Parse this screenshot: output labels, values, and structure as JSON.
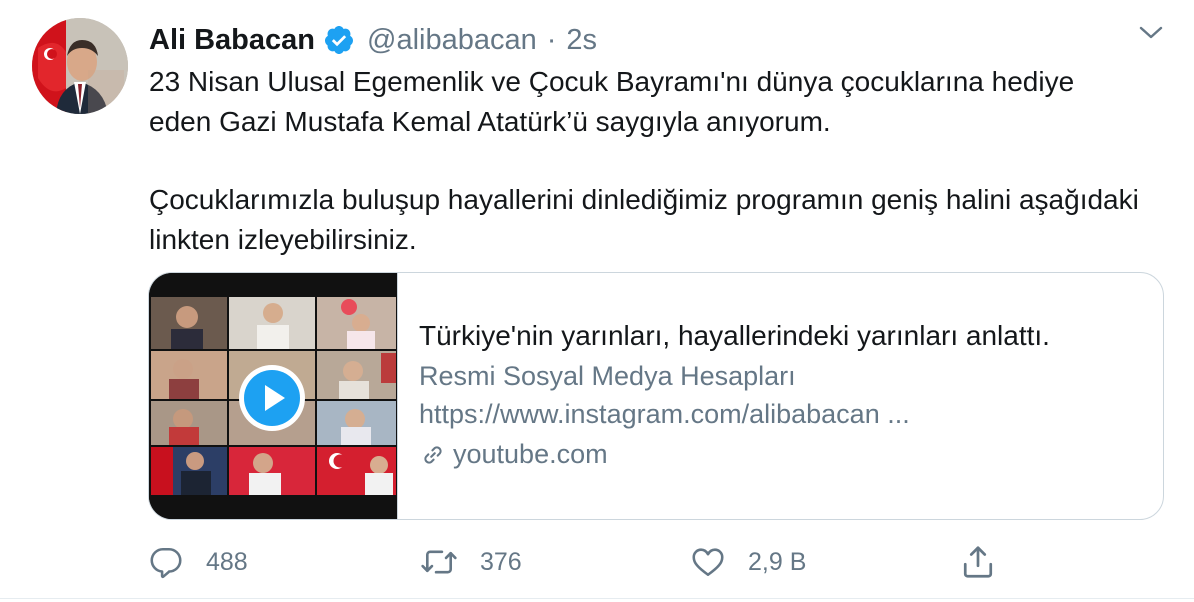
{
  "tweet": {
    "display_name": "Ali Babacan",
    "handle": "@alibabacan",
    "separator": "·",
    "time": "2s",
    "text_lines": [
      "23 Nisan Ulusal Egemenlik ve Çocuk Bayramı'nı dünya çocuklarına hediye",
      "eden Gazi Mustafa Kemal Atatürk’ü saygıyla anıyorum.",
      "Çocuklarımızla buluşup hayallerini dinlediğimiz programın geniş halini aşağıdaki",
      "linkten izleyebilirsiniz."
    ]
  },
  "card": {
    "title": "Türkiye'nin yarınları, hayallerindeki yarınları anlattı.",
    "description_line1": "Resmi Sosyal Medya Hesapları",
    "description_line2": "https://www.instagram.com/alibabacan ...",
    "domain": "youtube.com"
  },
  "actions": {
    "reply_count": "488",
    "retweet_count": "376",
    "like_count": "2,9 B"
  },
  "colors": {
    "accent": "#1da1f2",
    "muted": "#657786",
    "text": "#14171a",
    "border": "#ccd6dd"
  },
  "icons": {
    "verified": "verified-badge-icon",
    "caret": "chevron-down-icon",
    "play": "play-icon",
    "link": "link-icon",
    "reply": "reply-icon",
    "retweet": "retweet-icon",
    "like": "heart-icon",
    "share": "share-icon"
  }
}
